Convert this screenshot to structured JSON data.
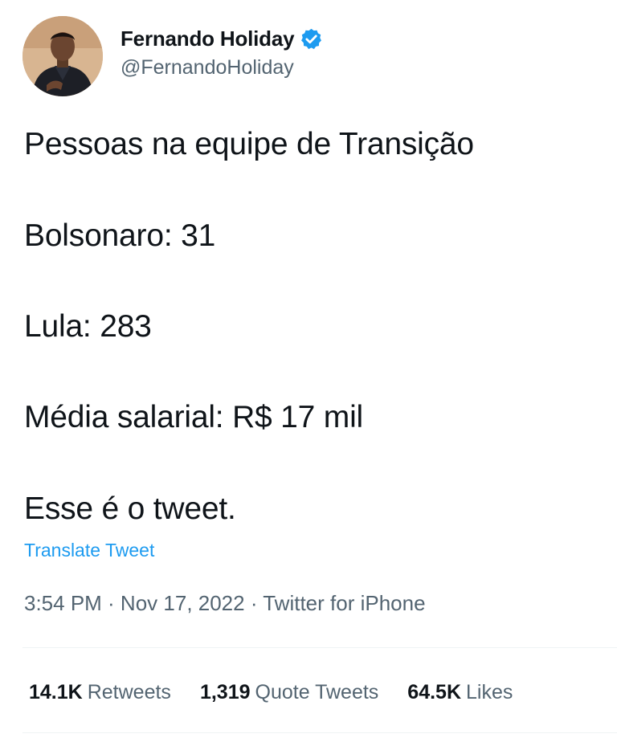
{
  "author": {
    "display_name": "Fernando Holiday",
    "handle": "@FernandoHoliday",
    "verified": true,
    "avatar_icon": "avatar-photo"
  },
  "tweet": {
    "lines": [
      "Pessoas na equipe de Transição",
      "Bolsonaro: 31",
      "Lula: 283",
      "Média salarial: R$ 17 mil",
      "Esse é o tweet."
    ],
    "translate_label": "Translate Tweet",
    "meta": "3:54 PM · Nov 17, 2022 · Twitter for iPhone"
  },
  "stats": {
    "retweets": {
      "value": "14.1K",
      "label": "Retweets"
    },
    "quote_tweets": {
      "value": "1,319",
      "label": "Quote Tweets"
    },
    "likes": {
      "value": "64.5K",
      "label": "Likes"
    }
  },
  "colors": {
    "link": "#1d9bf0",
    "secondary_text": "#536471",
    "verified_badge": "#1d9bf0"
  }
}
